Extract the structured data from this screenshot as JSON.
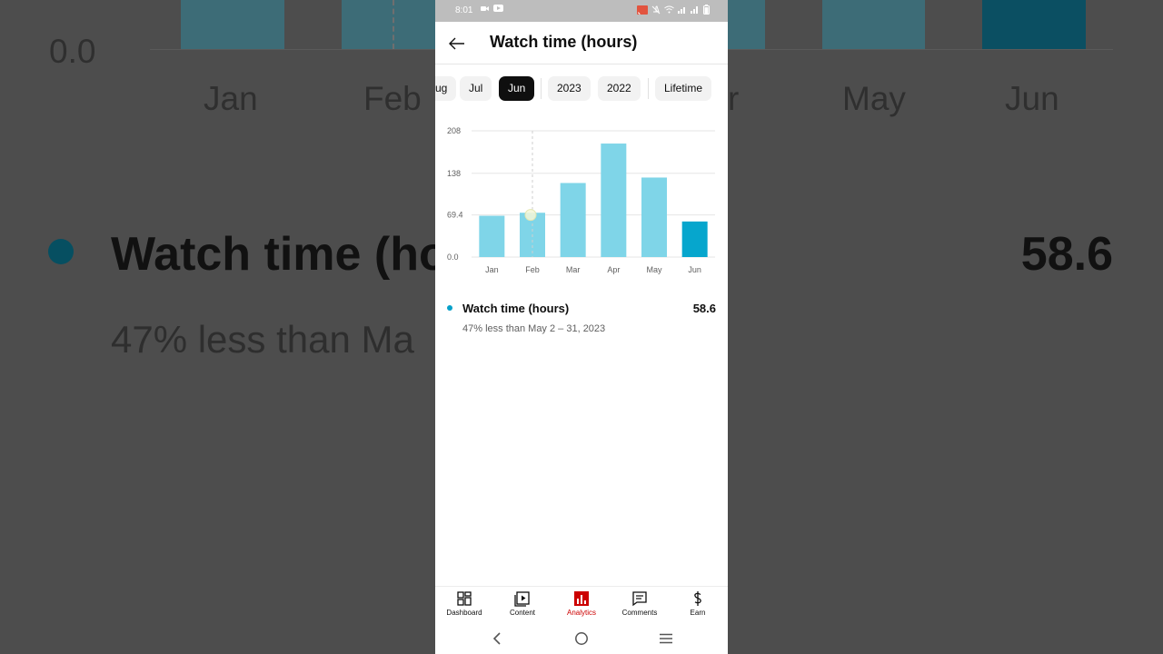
{
  "background": {
    "y_label": "0.0",
    "ticks": [
      "Jan",
      "Feb",
      "Apr",
      "May",
      "Jun"
    ],
    "title": "Watch time (ho",
    "value": "58.6",
    "subtitle": "47% less than Ma"
  },
  "status_bar": {
    "time": "8:01"
  },
  "header": {
    "title": "Watch time (hours)",
    "back_icon": "arrow-left-icon"
  },
  "period_chips": [
    {
      "label": "ug",
      "active": false
    },
    {
      "label": "Jul",
      "active": false
    },
    {
      "label": "Jun",
      "active": true
    },
    {
      "label": "2023",
      "active": false
    },
    {
      "label": "2022",
      "active": false
    },
    {
      "label": "Lifetime",
      "active": false
    }
  ],
  "chart_data": {
    "type": "bar",
    "categories": [
      "Jan",
      "Feb",
      "Mar",
      "Apr",
      "May",
      "Jun"
    ],
    "values": [
      68,
      73,
      122,
      187,
      131,
      58.6
    ],
    "y_ticks": [
      "208",
      "138",
      "69.4",
      "0.0"
    ],
    "y_tick_values": [
      208,
      138,
      69.4,
      0
    ],
    "ylim": [
      0,
      208
    ],
    "highlighted_index": 5,
    "hover_index": 1,
    "grid": true,
    "colors": {
      "bar": "#7fd5e8",
      "highlight": "#06a6cd",
      "grid": "#e5e5e5",
      "axis_text": "#606060"
    }
  },
  "metric": {
    "label": "Watch time (hours)",
    "value": "58.6",
    "comparison": "47% less than May 2 – 31, 2023",
    "color": "#06a0c9"
  },
  "bottom_nav": [
    {
      "label": "Dashboard",
      "icon": "dashboard-icon",
      "active": false
    },
    {
      "label": "Content",
      "icon": "content-icon",
      "active": false
    },
    {
      "label": "Analytics",
      "icon": "analytics-icon",
      "active": true
    },
    {
      "label": "Comments",
      "icon": "comments-icon",
      "active": false
    },
    {
      "label": "Earn",
      "icon": "dollar-icon",
      "active": false
    }
  ],
  "system_nav": {
    "back": "back-icon",
    "home": "home-icon",
    "recents": "menu-icon"
  }
}
